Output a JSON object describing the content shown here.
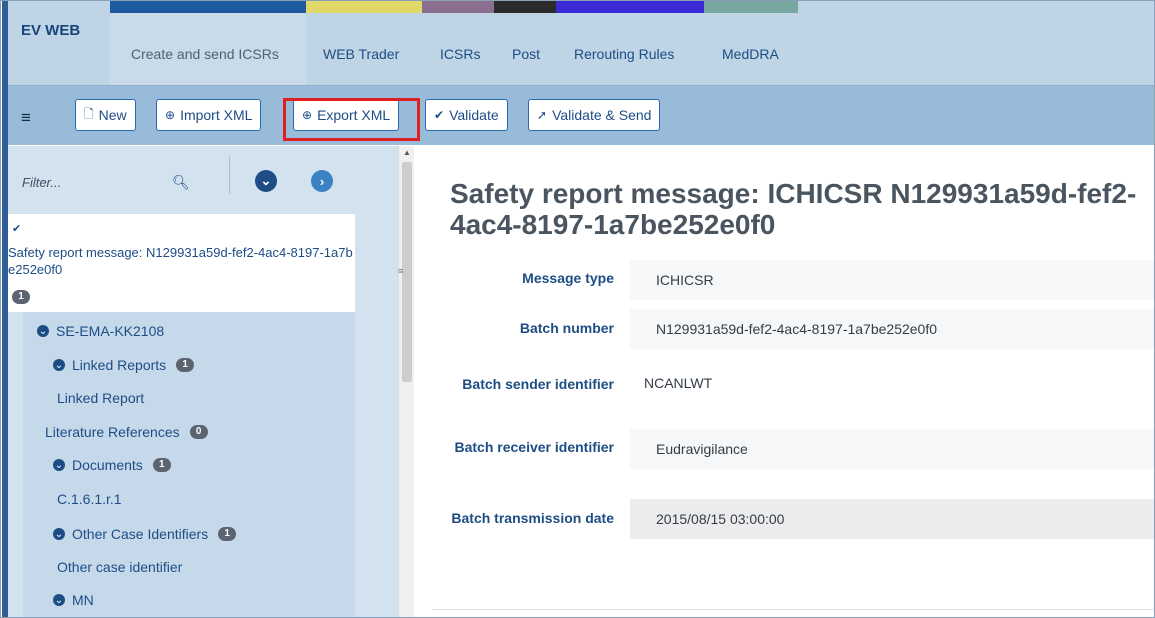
{
  "nav": {
    "brand": "EV WEB",
    "items": [
      "Create and send ICSRs",
      "WEB Trader",
      "ICSRs",
      "Post",
      "Rerouting Rules",
      "MedDRA"
    ],
    "active_index": 0
  },
  "toolbar": {
    "menu_icon": "≡",
    "new_label": "New",
    "import_label": "Import XML",
    "export_label": "Export XML",
    "validate_label": "Validate",
    "validate_send_label": "Validate & Send"
  },
  "sidebar": {
    "filter_placeholder": "Filter...",
    "root": {
      "label": "Safety report message: N129931a59d-fef2-4ac4-8197-1a7be252e0f0",
      "badge": "1"
    },
    "nodes": [
      {
        "label": "SE-EMA-KK2108",
        "badge": ""
      },
      {
        "label": "Linked Reports",
        "badge": "1"
      },
      {
        "label": "Linked Report",
        "badge": ""
      },
      {
        "label": "Literature References",
        "badge": "0"
      },
      {
        "label": "Documents",
        "badge": "1"
      },
      {
        "label": "C.1.6.1.r.1",
        "badge": ""
      },
      {
        "label": "Other Case Identifiers",
        "badge": "1"
      },
      {
        "label": "Other case identifier",
        "badge": ""
      },
      {
        "label": "MN",
        "badge": ""
      }
    ]
  },
  "content": {
    "title": "Safety report message: ICHICSR N129931a59d-fef2-4ac4-8197-1a7be252e0f0",
    "fields": [
      {
        "label": "Message type",
        "value": "ICHICSR"
      },
      {
        "label": "Batch number",
        "value": "N129931a59d-fef2-4ac4-8197-1a7be252e0f0"
      },
      {
        "label": "Batch sender identifier",
        "value": "NCANLWT"
      },
      {
        "label": "Batch receiver identifier",
        "value": "Eudravigilance"
      },
      {
        "label": "Batch transmission date",
        "value": "2015/08/15 03:00:00"
      }
    ]
  },
  "colors": {
    "nav_bg": "#bfd4e4",
    "toolbar_bg": "#97bbd9",
    "sidebar_bg": "#d2e2ef",
    "accent": "#1e4d86",
    "highlight": "#e02020"
  }
}
